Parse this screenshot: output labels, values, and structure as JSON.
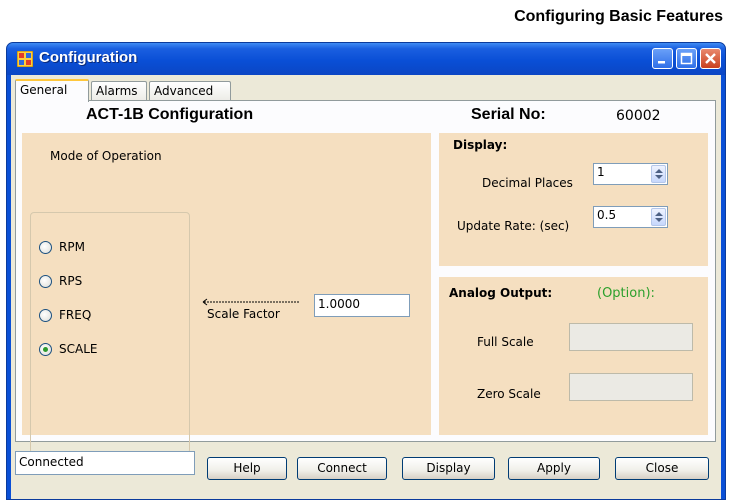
{
  "page_heading": "Configuring Basic Features",
  "window": {
    "title": "Configuration"
  },
  "tabs": [
    {
      "label": "General",
      "active": true
    },
    {
      "label": "Alarms",
      "active": false
    },
    {
      "label": "Advanced",
      "active": false
    }
  ],
  "general": {
    "heading": "ACT-1B Configuration",
    "serial_label": "Serial No:",
    "serial_value": "60002",
    "mode_label": "Mode of Operation",
    "modes": [
      {
        "label": "RPM",
        "selected": false
      },
      {
        "label": "RPS",
        "selected": false
      },
      {
        "label": "FREQ",
        "selected": false
      },
      {
        "label": "SCALE",
        "selected": true
      }
    ],
    "scale_factor_label": "Scale Factor",
    "scale_factor_value": "1.0000",
    "display": {
      "title": "Display:",
      "decimal_places_label": "Decimal Places",
      "decimal_places_value": "1",
      "update_rate_label": "Update Rate: (sec)",
      "update_rate_value": "0.5"
    },
    "analog_output": {
      "title": "Analog Output:",
      "option_label": "(Option):",
      "full_scale_label": "Full Scale",
      "full_scale_value": "",
      "zero_scale_label": "Zero Scale",
      "zero_scale_value": ""
    }
  },
  "status": "Connected",
  "buttons": {
    "help": "Help",
    "connect": "Connect",
    "display": "Display",
    "apply": "Apply",
    "close": "Close"
  },
  "colors": {
    "panel": "#f5dfc0",
    "titlebar": "#0a4fd6",
    "option_text": "#2ca02c"
  }
}
